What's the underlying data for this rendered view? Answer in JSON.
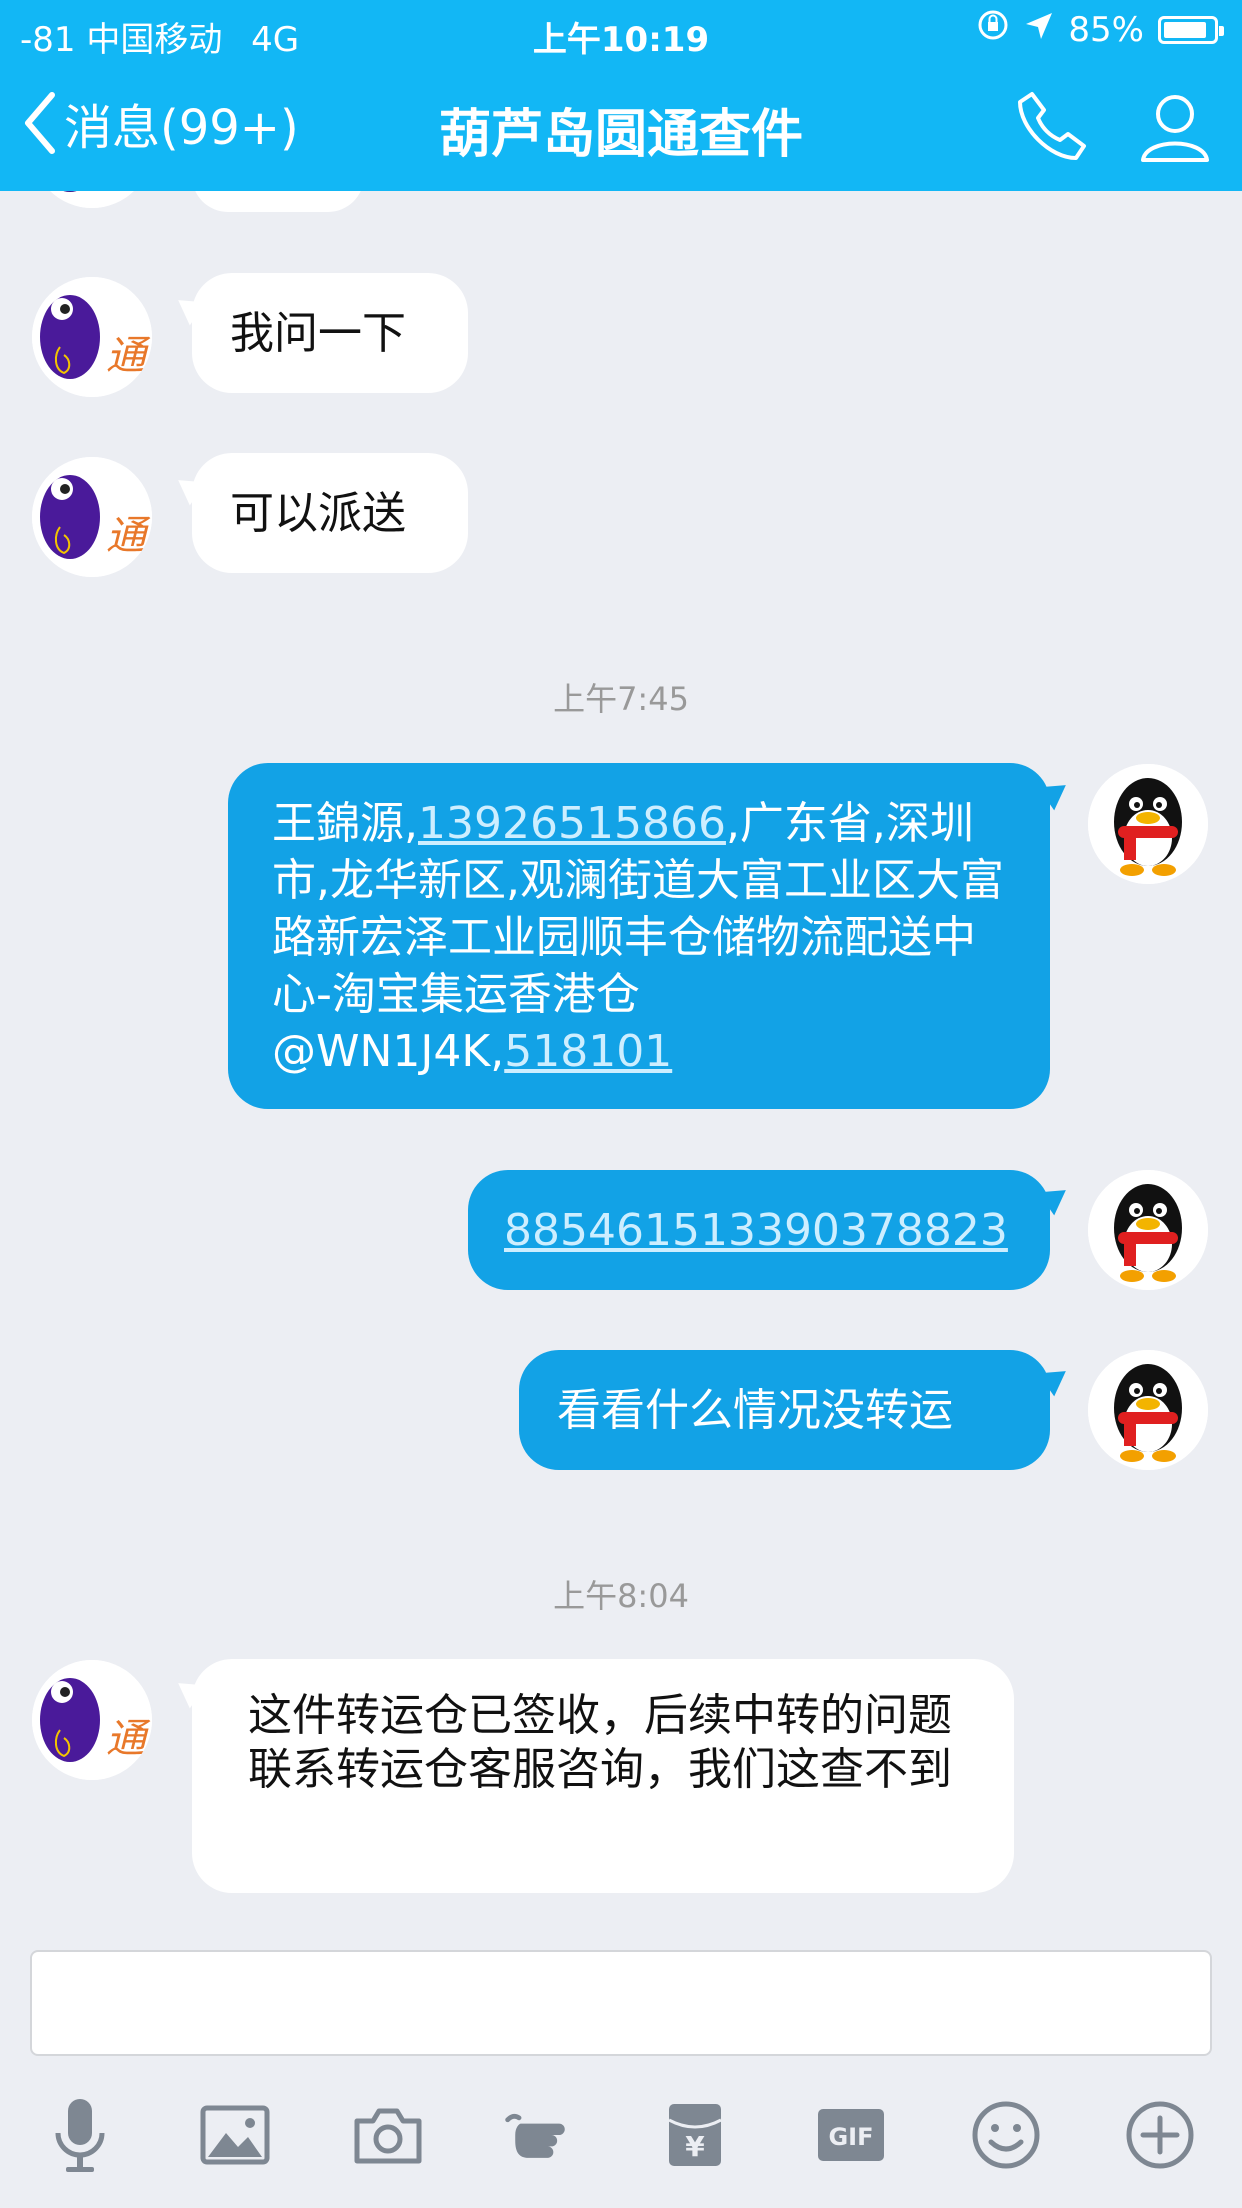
{
  "status": {
    "carrier": "-81 中国移动",
    "network": "4G",
    "time": "上午10:19",
    "battery": "85%"
  },
  "nav": {
    "back_label": "消息(99+)",
    "title": "葫芦岛圆通查件"
  },
  "messages": [
    {
      "from": "contact",
      "text": "我问一下"
    },
    {
      "from": "contact",
      "text": "可以派送"
    },
    {
      "type": "timestamp",
      "text": "上午7:45"
    },
    {
      "from": "me",
      "parts": [
        "王錦源,",
        "13926515866",
        ",广东省,深圳市,龙华新区,观澜街道大富工业区大富路新宏泽工业园顺丰仓储物流配送中心-淘宝集运香港仓@WN1J4K,",
        "518101"
      ]
    },
    {
      "from": "me",
      "text": "885461513390378823"
    },
    {
      "from": "me",
      "text": "看看什么情况没转运"
    },
    {
      "type": "timestamp",
      "text": "上午8:04"
    },
    {
      "from": "contact",
      "text": "这件转运仓已签收，后续中转的问题联系转运仓客服咨询，我们这查不到"
    }
  ],
  "contact_avatar_text": "通",
  "input": {
    "value": "",
    "placeholder": ""
  },
  "toolbar": {
    "icons": [
      "microphone-icon",
      "image-icon",
      "camera-icon",
      "poke-icon",
      "red-packet-icon",
      "gif-icon",
      "emoji-icon",
      "plus-icon"
    ],
    "gif_label": "GIF",
    "yen_label": "¥"
  },
  "colors": {
    "accent": "#12b7f5",
    "out_bubble": "#12a2e6",
    "background": "#eceef3"
  }
}
